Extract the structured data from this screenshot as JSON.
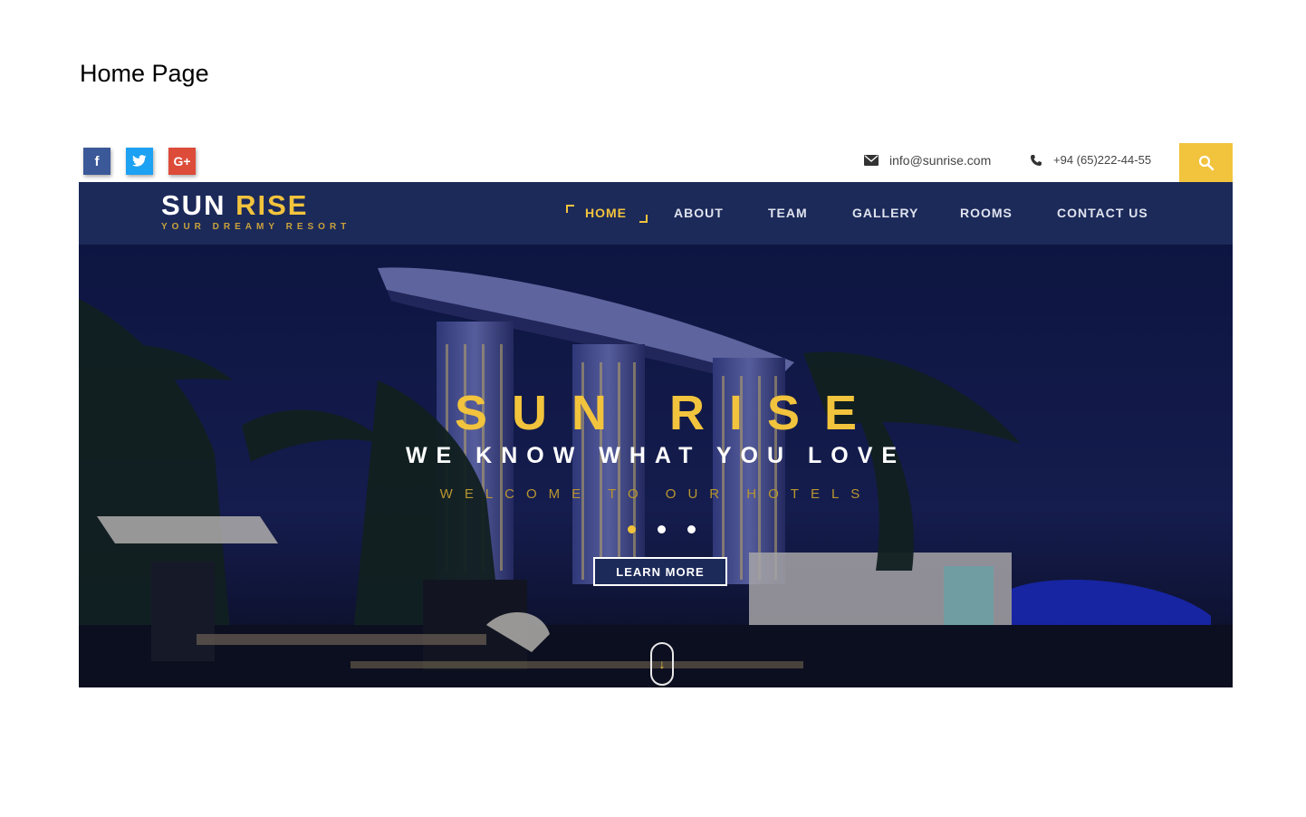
{
  "document": {
    "title": "Home Page"
  },
  "topbar": {
    "social": [
      {
        "name": "facebook",
        "glyph": "f",
        "color": "#3b5998"
      },
      {
        "name": "twitter",
        "glyph": "t",
        "color": "#1da1f2"
      },
      {
        "name": "google-plus",
        "glyph": "G+",
        "color": "#dd4b39"
      }
    ],
    "email": "info@sunrise.com",
    "phone": "+94 (65)222-44-55",
    "search_color": "#f2c33c"
  },
  "nav": {
    "logo_sun": "SUN",
    "logo_rise": "RISE",
    "tagline": "YOUR DREAMY RESORT",
    "items": [
      {
        "label": "HOME",
        "active": true
      },
      {
        "label": "ABOUT"
      },
      {
        "label": "TEAM"
      },
      {
        "label": "GALLERY"
      },
      {
        "label": "ROOMS"
      },
      {
        "label": "CONTACT US"
      }
    ]
  },
  "hero": {
    "title": "SUN RISE",
    "subtitle": "WE KNOW WHAT YOU LOVE",
    "welcome": "WELCOME TO OUR HOTELS",
    "slides_count": 3,
    "active_slide": 1,
    "cta": "LEARN MORE",
    "scroll_glyph": "↓"
  },
  "colors": {
    "accent": "#f2c33c",
    "navy": "#1c2a5a"
  }
}
